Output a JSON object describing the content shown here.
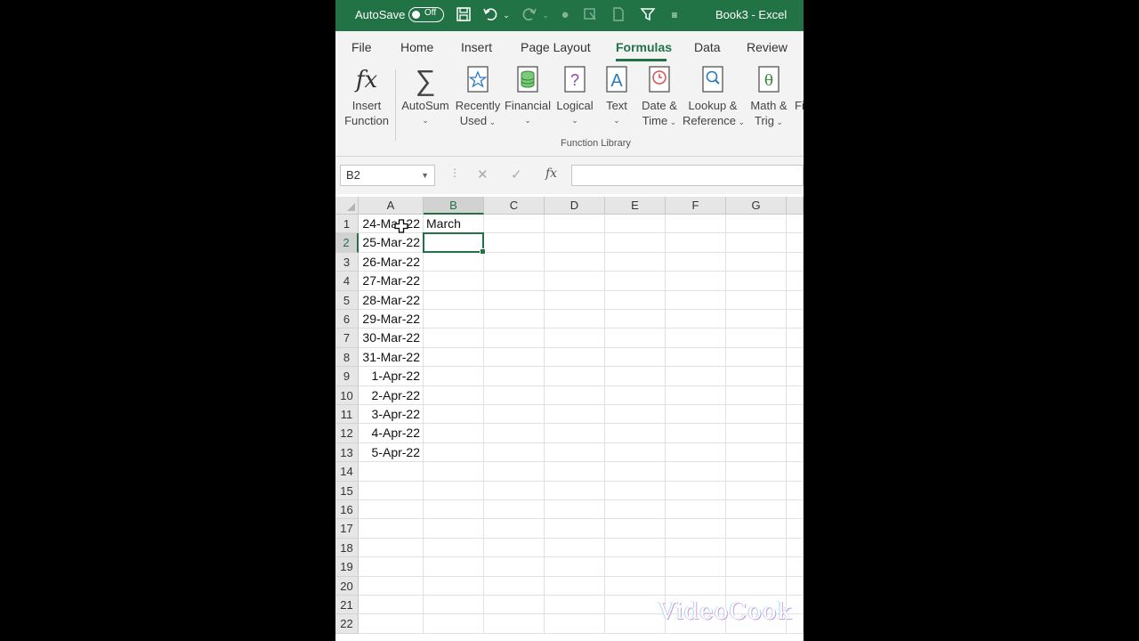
{
  "titlebar": {
    "autosave_label": "AutoSave",
    "autosave_state": "Off",
    "title": "Book3  -  Excel",
    "accent": "#217346"
  },
  "tabs": [
    {
      "label": "File",
      "active": false
    },
    {
      "label": "Home",
      "active": false
    },
    {
      "label": "Insert",
      "active": false
    },
    {
      "label": "Page Layout",
      "active": false
    },
    {
      "label": "Formulas",
      "active": true
    },
    {
      "label": "Data",
      "active": false
    },
    {
      "label": "Review",
      "active": false
    }
  ],
  "ribbon": {
    "group_label": "Function Library",
    "buttons": [
      {
        "line1": "Insert",
        "line2": "Function",
        "icon": "fx-icon"
      },
      {
        "line1": "AutoSum",
        "line2": "",
        "icon": "sigma-icon"
      },
      {
        "line1": "Recently",
        "line2": "Used",
        "icon": "star-book-icon"
      },
      {
        "line1": "Financial",
        "line2": "",
        "icon": "coins-book-icon"
      },
      {
        "line1": "Logical",
        "line2": "",
        "icon": "question-book-icon"
      },
      {
        "line1": "Text",
        "line2": "",
        "icon": "letter-a-book-icon"
      },
      {
        "line1": "Date &",
        "line2": "Time",
        "icon": "clock-book-icon"
      },
      {
        "line1": "Lookup &",
        "line2": "Reference",
        "icon": "magnifier-book-icon"
      },
      {
        "line1": "Math &",
        "line2": "Trig",
        "icon": "theta-book-icon"
      },
      {
        "line1": "Fi",
        "line2": "",
        "icon": "more-functions-icon"
      }
    ]
  },
  "formula_bar": {
    "name_box": "B2",
    "fx_label": "fx",
    "value": ""
  },
  "sheet": {
    "columns": [
      "A",
      "B",
      "C",
      "D",
      "E",
      "F",
      "G"
    ],
    "selected_column": "B",
    "selected_row": 2,
    "rows": [
      {
        "n": "1",
        "a": "24-Mar-22",
        "b": "March"
      },
      {
        "n": "2",
        "a": "25-Mar-22",
        "b": ""
      },
      {
        "n": "3",
        "a": "26-Mar-22",
        "b": ""
      },
      {
        "n": "4",
        "a": "27-Mar-22",
        "b": ""
      },
      {
        "n": "5",
        "a": "28-Mar-22",
        "b": ""
      },
      {
        "n": "6",
        "a": "29-Mar-22",
        "b": ""
      },
      {
        "n": "7",
        "a": "30-Mar-22",
        "b": ""
      },
      {
        "n": "8",
        "a": "31-Mar-22",
        "b": ""
      },
      {
        "n": "9",
        "a": "1-Apr-22",
        "b": ""
      },
      {
        "n": "10",
        "a": "2-Apr-22",
        "b": ""
      },
      {
        "n": "11",
        "a": "3-Apr-22",
        "b": ""
      },
      {
        "n": "12",
        "a": "4-Apr-22",
        "b": ""
      },
      {
        "n": "13",
        "a": "5-Apr-22",
        "b": ""
      },
      {
        "n": "14",
        "a": "",
        "b": ""
      },
      {
        "n": "15",
        "a": "",
        "b": ""
      },
      {
        "n": "16",
        "a": "",
        "b": ""
      },
      {
        "n": "17",
        "a": "",
        "b": ""
      },
      {
        "n": "18",
        "a": "",
        "b": ""
      },
      {
        "n": "19",
        "a": "",
        "b": ""
      },
      {
        "n": "20",
        "a": "",
        "b": ""
      },
      {
        "n": "21",
        "a": "",
        "b": ""
      },
      {
        "n": "22",
        "a": "",
        "b": ""
      }
    ]
  },
  "watermark": "VideoCook"
}
